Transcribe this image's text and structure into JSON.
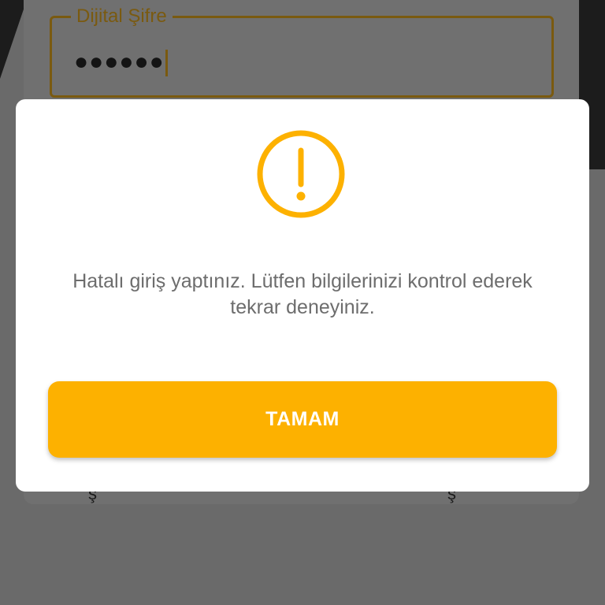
{
  "background": {
    "pin_field": {
      "label": "Dijital Şifre",
      "masked_value": "●●●●●●"
    },
    "marks": [
      "ş",
      "ş"
    ]
  },
  "dialog": {
    "icon": "exclamation-circle-icon",
    "message": "Hatalı giriş yaptınız. Lütfen bilgilerinizi kontrol ederek tekrar deneyiniz.",
    "ok_button_label": "TAMAM"
  },
  "colors": {
    "accent": "#fdb100",
    "dimmed_accent": "#7a5a10",
    "overlay": "#6a6a6a",
    "message_text": "#6d6d6d",
    "button_text": "#ffffff"
  }
}
